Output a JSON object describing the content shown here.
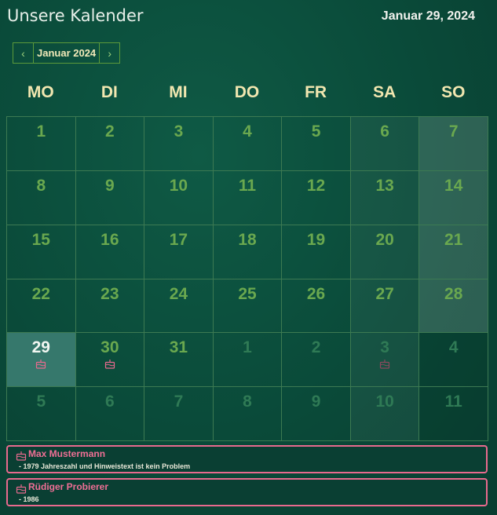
{
  "header": {
    "title": "Unsere Kalender",
    "date": "Januar 29, 2024"
  },
  "nav": {
    "prev": "‹",
    "month": "Januar 2024",
    "next": "›"
  },
  "weekdays": [
    "MO",
    "DI",
    "MI",
    "DO",
    "FR",
    "SA",
    "SO"
  ],
  "weeks": [
    [
      {
        "d": "1"
      },
      {
        "d": "2"
      },
      {
        "d": "3"
      },
      {
        "d": "4"
      },
      {
        "d": "5"
      },
      {
        "d": "6"
      },
      {
        "d": "7"
      }
    ],
    [
      {
        "d": "8"
      },
      {
        "d": "9"
      },
      {
        "d": "10"
      },
      {
        "d": "11"
      },
      {
        "d": "12"
      },
      {
        "d": "13"
      },
      {
        "d": "14"
      }
    ],
    [
      {
        "d": "15"
      },
      {
        "d": "16"
      },
      {
        "d": "17"
      },
      {
        "d": "18"
      },
      {
        "d": "19"
      },
      {
        "d": "20"
      },
      {
        "d": "21"
      }
    ],
    [
      {
        "d": "22"
      },
      {
        "d": "23"
      },
      {
        "d": "24"
      },
      {
        "d": "25"
      },
      {
        "d": "26"
      },
      {
        "d": "27"
      },
      {
        "d": "28"
      }
    ],
    [
      {
        "d": "29",
        "today": true,
        "birthday": true
      },
      {
        "d": "30",
        "birthday": true
      },
      {
        "d": "31"
      },
      {
        "d": "1",
        "other": true
      },
      {
        "d": "2",
        "other": true
      },
      {
        "d": "3",
        "other": true,
        "birthday": true
      },
      {
        "d": "4",
        "other": true
      }
    ],
    [
      {
        "d": "5",
        "other": true
      },
      {
        "d": "6",
        "other": true
      },
      {
        "d": "7",
        "other": true
      },
      {
        "d": "8",
        "other": true
      },
      {
        "d": "9",
        "other": true
      },
      {
        "d": "10",
        "other": true
      },
      {
        "d": "11",
        "other": true
      }
    ]
  ],
  "events": [
    {
      "icon": "birthday-cake-icon",
      "name": "Max Mustermann",
      "note": "- 1979  Jahreszahl und Hinweistext ist kein Problem"
    },
    {
      "icon": "birthday-cake-icon",
      "name": "Rüdiger Probierer",
      "note": "- 1986"
    }
  ],
  "colors": {
    "accent": "#6aa84f",
    "event_border": "#e86a8e",
    "today_bg": "#36786c"
  }
}
